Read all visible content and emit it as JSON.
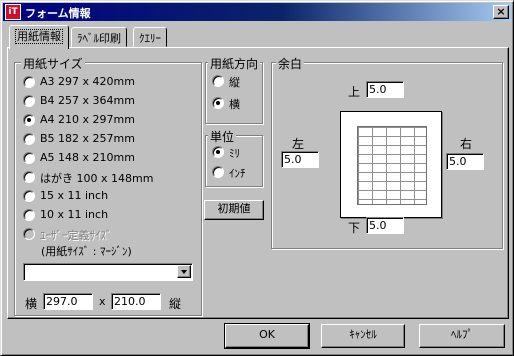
{
  "window": {
    "title": "フォーム情報",
    "icon_letter": "iT",
    "close_label": "×"
  },
  "tabs": [
    {
      "label": "用紙情報"
    },
    {
      "label": "ﾗﾍﾞﾙ印刷"
    },
    {
      "label": "ｸｴﾘｰ"
    }
  ],
  "paper_size": {
    "group_label": "用紙サイズ",
    "options": [
      {
        "label": "A3 297 x 420mm",
        "checked": false,
        "enabled": true
      },
      {
        "label": "B4 257 x 364mm",
        "checked": false,
        "enabled": true
      },
      {
        "label": "A4 210 x 297mm",
        "checked": true,
        "enabled": true
      },
      {
        "label": "B5 182 x 257mm",
        "checked": false,
        "enabled": true
      },
      {
        "label": "A5 148 x 210mm",
        "checked": false,
        "enabled": true
      },
      {
        "label": "はがき 100 x 148mm",
        "checked": false,
        "enabled": true
      },
      {
        "label": "15 x 11 inch",
        "checked": false,
        "enabled": true
      },
      {
        "label": "10 x 11 inch",
        "checked": false,
        "enabled": true
      },
      {
        "label": "ﾕｰｻﾞｰ定義ｻｲｽﾞ",
        "checked": false,
        "enabled": false
      }
    ],
    "user_note": "(用紙ｻｲｽﾞ : ﾏｰｼﾞﾝ)",
    "combo_value": "",
    "width_label": "横",
    "width_value": "297.0",
    "x_label": "x",
    "height_value": "210.0",
    "height_label": "縦"
  },
  "orientation": {
    "group_label": "用紙方向",
    "options": [
      {
        "label": "縦",
        "checked": false
      },
      {
        "label": "横",
        "checked": true
      }
    ]
  },
  "unit": {
    "group_label": "単位",
    "options": [
      {
        "label": "ﾐﾘ",
        "checked": true
      },
      {
        "label": "ｲﾝﾁ",
        "checked": false
      }
    ]
  },
  "reset_label": "初期値",
  "margins": {
    "group_label": "余白",
    "top_label": "上",
    "top_value": "5.0",
    "left_label": "左",
    "left_value": "5.0",
    "right_label": "右",
    "right_value": "5.0",
    "bottom_label": "下",
    "bottom_value": "5.0"
  },
  "buttons": {
    "ok": "OK",
    "cancel": "ｷｬﾝｾﾙ",
    "help": "ﾍﾙﾌﾟ"
  }
}
